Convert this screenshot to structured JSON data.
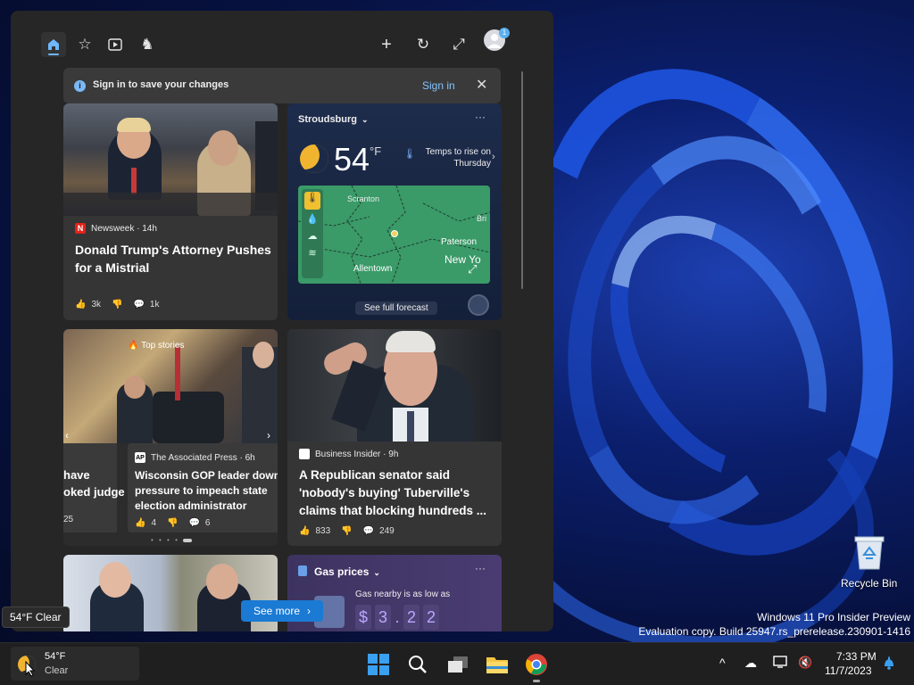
{
  "panel": {
    "toolbar": {
      "home_icon": "home-icon",
      "favorites_icon": "star-add-icon",
      "video_icon": "play-icon",
      "games_icon": "chess-icon",
      "add_icon": "plus-icon",
      "refresh_icon": "refresh-icon",
      "expand_icon": "expand-icon",
      "profile_badge": "1"
    },
    "signin_bar": {
      "text": "Sign in to save your changes",
      "link": "Sign in"
    },
    "card1": {
      "source": "Newsweek · 14h",
      "logo": "N",
      "headline": "Donald Trump's Attorney Pushes for a Mistrial",
      "likes": "3k",
      "comments": "1k"
    },
    "weather": {
      "location": "Stroudsburg",
      "temp": "54",
      "unit": "°F",
      "note_line1": "Temps to rise on",
      "note_line2": "Thursday",
      "map_labels": [
        "Scranton",
        "Bri",
        "Paterson",
        "New Yo",
        "Allentown"
      ],
      "forecast_button": "See full forecast"
    },
    "card3": {
      "badge": "Top stories",
      "left_snippet_1": "have",
      "left_snippet_2": "oked judge",
      "left_snippet_3": "25",
      "source": "The Associated Press · 6h",
      "logo": "AP",
      "headline": "Wisconsin GOP leader down pressure to impeach state election administrator",
      "likes": "4",
      "comments": "6"
    },
    "card4": {
      "source": "Business Insider · 9h",
      "headline": "A Republican senator said 'nobody's buying' Tuberville's claims that blocking hundreds ...",
      "likes": "833",
      "comments": "249"
    },
    "gas": {
      "title": "Gas prices",
      "subtitle": "Gas nearby is as low as",
      "price_digits": [
        "$",
        "3",
        ".",
        "2",
        "2"
      ]
    },
    "see_more": "See more"
  },
  "tooltip": "54°F Clear",
  "desktop": {
    "recycle_bin": "Recycle Bin",
    "watermark_line1": "Windows 11 Pro Insider Preview",
    "watermark_line2": "Evaluation copy. Build 25947.rs_prerelease.230901-1416"
  },
  "taskbar": {
    "weather_temp": "54°F",
    "weather_cond": "Clear",
    "time": "7:33 PM",
    "date": "11/7/2023",
    "apps": [
      "windows-start-icon",
      "search-icon",
      "task-view-icon",
      "file-explorer-icon",
      "chrome-icon"
    ]
  }
}
